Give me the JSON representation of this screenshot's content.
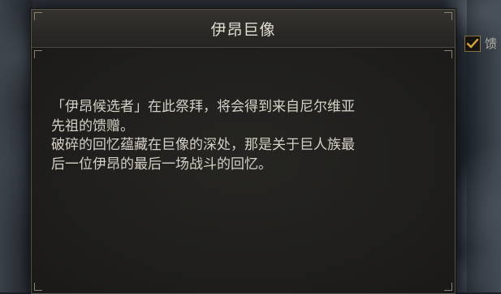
{
  "dialog": {
    "title": "伊昂巨像",
    "description_lines": [
      "「伊昂候选者」在此祭拜，将会得到来自尼尔维亚",
      "先祖的馈赠。",
      "破碎的回忆蕴藏在巨像的深处，那是关于巨人族最",
      "后一位伊昂的最后一场战斗的回忆。"
    ]
  },
  "side_option": {
    "label_partial": "馈",
    "checked": true,
    "check_color": "#d9a83a"
  },
  "colors": {
    "title_text": "#e2ddd2",
    "body_text": "#d6d1c6",
    "panel_bg": "#1d1c1a",
    "accent": "#d9a83a"
  },
  "icons": [
    "checkmark-icon"
  ]
}
